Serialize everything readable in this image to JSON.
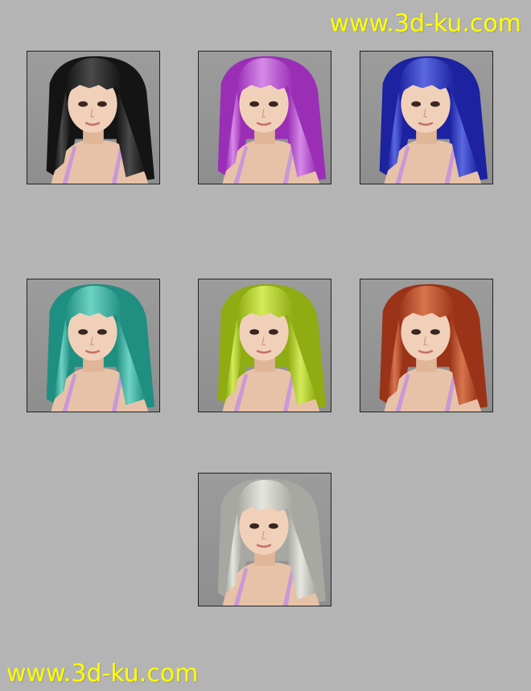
{
  "watermark": {
    "text": "www.3d-ku.com"
  },
  "variants": [
    {
      "name": "black",
      "hair": "#141414",
      "shine": "#4a4a4a"
    },
    {
      "name": "purple",
      "hair": "#9a2fb6",
      "shine": "#d68ae6"
    },
    {
      "name": "blue",
      "hair": "#1c22a0",
      "shine": "#5b68e0"
    },
    {
      "name": "teal",
      "hair": "#1f8f82",
      "shine": "#6fd3c4"
    },
    {
      "name": "lime",
      "hair": "#8fac12",
      "shine": "#d4ea5a"
    },
    {
      "name": "red",
      "hair": "#9a3318",
      "shine": "#d7754e"
    },
    {
      "name": "silver",
      "hair": "#a8a8a2",
      "shine": "#e6e6e0"
    }
  ]
}
